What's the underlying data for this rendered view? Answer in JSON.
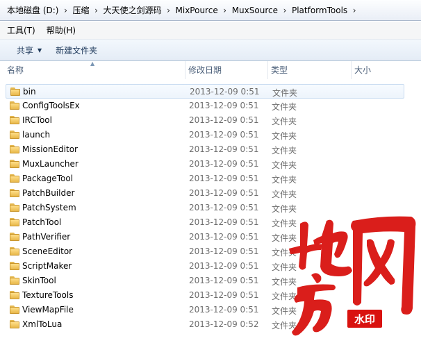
{
  "breadcrumb": [
    "本地磁盘 (D:)",
    "压缩",
    "大天使之剑源码",
    "MixPource",
    "MuxSource",
    "PlatformTools"
  ],
  "menu": {
    "tools": "工具(T)",
    "help": "帮助(H)"
  },
  "toolbar": {
    "share": "共享",
    "new_folder": "新建文件夹"
  },
  "columns": {
    "name": "名称",
    "date": "修改日期",
    "type": "类型",
    "size": "大小"
  },
  "files": [
    {
      "name": "bin",
      "date": "2013-12-09 0:51",
      "type": "文件夹"
    },
    {
      "name": "ConfigToolsEx",
      "date": "2013-12-09 0:51",
      "type": "文件夹"
    },
    {
      "name": "IRCTool",
      "date": "2013-12-09 0:51",
      "type": "文件夹"
    },
    {
      "name": "launch",
      "date": "2013-12-09 0:51",
      "type": "文件夹"
    },
    {
      "name": "MissionEditor",
      "date": "2013-12-09 0:51",
      "type": "文件夹"
    },
    {
      "name": "MuxLauncher",
      "date": "2013-12-09 0:51",
      "type": "文件夹"
    },
    {
      "name": "PackageTool",
      "date": "2013-12-09 0:51",
      "type": "文件夹"
    },
    {
      "name": "PatchBuilder",
      "date": "2013-12-09 0:51",
      "type": "文件夹"
    },
    {
      "name": "PatchSystem",
      "date": "2013-12-09 0:51",
      "type": "文件夹"
    },
    {
      "name": "PatchTool",
      "date": "2013-12-09 0:51",
      "type": "文件夹"
    },
    {
      "name": "PathVerifier",
      "date": "2013-12-09 0:51",
      "type": "文件夹"
    },
    {
      "name": "SceneEditor",
      "date": "2013-12-09 0:51",
      "type": "文件夹"
    },
    {
      "name": "ScriptMaker",
      "date": "2013-12-09 0:51",
      "type": "文件夹"
    },
    {
      "name": "SkinTool",
      "date": "2013-12-09 0:51",
      "type": "文件夹"
    },
    {
      "name": "TextureTools",
      "date": "2013-12-09 0:51",
      "type": "文件夹"
    },
    {
      "name": "ViewMapFile",
      "date": "2013-12-09 0:51",
      "type": "文件夹"
    },
    {
      "name": "XmlToLua",
      "date": "2013-12-09 0:52",
      "type": "文件夹"
    }
  ],
  "watermark": {
    "text": "地方网",
    "badge": "水印",
    "color": "#d9120f"
  },
  "colors": {
    "selected_row_border": "#c9dcf1",
    "toolbar_text": "#1e395b",
    "folder": "#e8b84a"
  }
}
